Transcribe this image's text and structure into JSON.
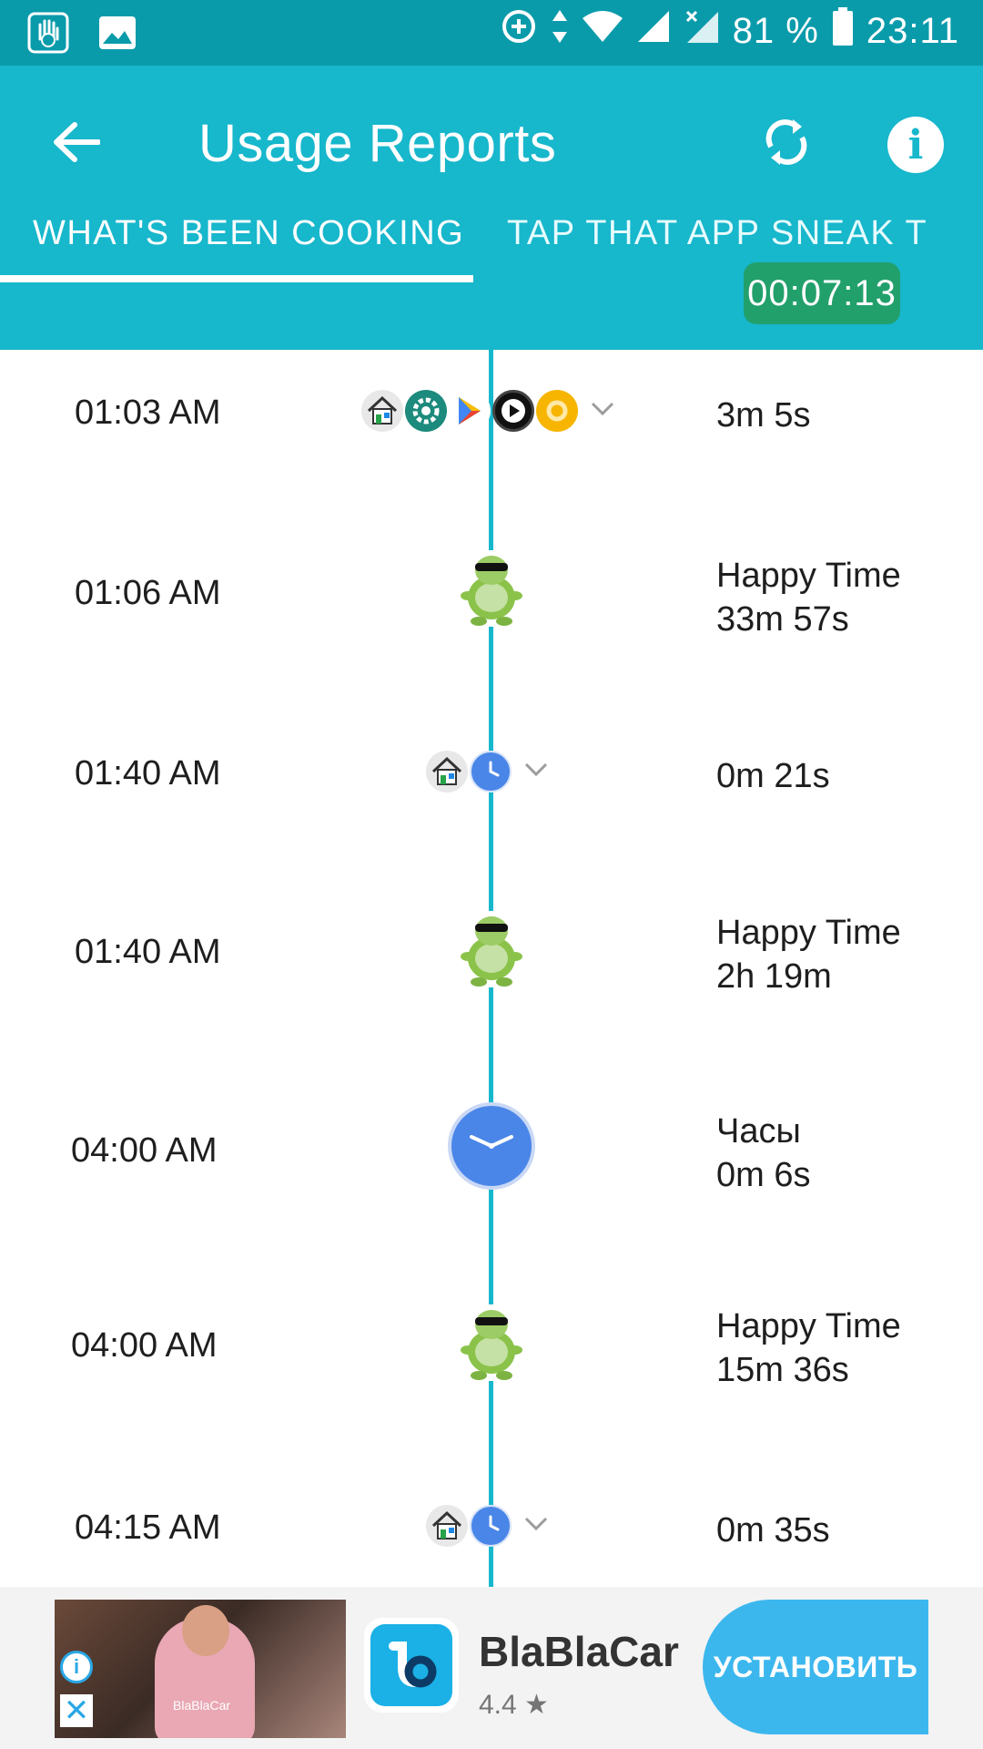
{
  "status_bar": {
    "battery": "81 %",
    "clock": "23:11"
  },
  "app_bar": {
    "title": "Usage Reports"
  },
  "tabs": [
    {
      "label": "WHAT'S BEEN COOKING",
      "selected": true
    },
    {
      "label": "TAP THAT APP   SNEAK T",
      "selected": false
    }
  ],
  "timer": "00:07:13",
  "timeline": [
    {
      "time": "01:03 AM",
      "icons": [
        "home-app-icon",
        "settings-gear-icon",
        "play-store-icon",
        "player-icon",
        "orange-ring-icon"
      ],
      "expandable": true,
      "lines": [
        "3m 5s"
      ]
    },
    {
      "time": "01:06 AM",
      "icons": [
        "turtle-icon"
      ],
      "expandable": false,
      "lines": [
        "Happy Time",
        "33m 57s"
      ]
    },
    {
      "time": "01:40 AM",
      "icons": [
        "home-app-icon",
        "clock-app-icon"
      ],
      "expandable": true,
      "lines": [
        "0m 21s"
      ]
    },
    {
      "time": "01:40 AM",
      "icons": [
        "turtle-icon"
      ],
      "expandable": false,
      "lines": [
        "Happy Time",
        "2h 19m"
      ]
    },
    {
      "time": "04:00 AM",
      "icons": [
        "clock-app-icon"
      ],
      "expandable": false,
      "lines": [
        "Часы",
        "0m 6s"
      ]
    },
    {
      "time": "04:00 AM",
      "icons": [
        "turtle-icon"
      ],
      "expandable": false,
      "lines": [
        "Happy Time",
        "15m 36s"
      ]
    },
    {
      "time": "04:15 AM",
      "icons": [
        "home-app-icon",
        "clock-app-icon"
      ],
      "expandable": true,
      "lines": [
        "0m 35s"
      ]
    }
  ],
  "ad": {
    "photo_text": "BlaBlaCar",
    "app_name": "BlaBlaCar",
    "rating": "4.4 ★",
    "install_label": "УСТАНОВИТЬ"
  },
  "colors": {
    "status_bar": "#0a9bab",
    "app_bar": "#17b7cc",
    "timer_bg": "#22a06b",
    "install_button": "#3cb7ee"
  }
}
